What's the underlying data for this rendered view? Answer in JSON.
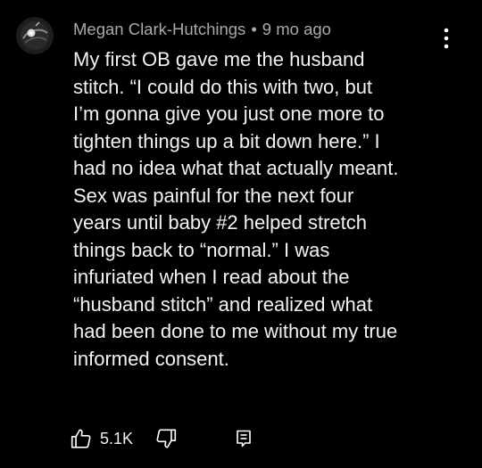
{
  "comment": {
    "author": "Megan Clark-Hutchings",
    "separator": "•",
    "timestamp": "9 mo ago",
    "text_lines": [
      "My first OB gave me the husband",
      "stitch. “I could do this with two, but",
      "I’m gonna give you just one more to",
      "tighten things up a bit down here.” I",
      "had no idea what that actually meant.",
      "Sex was painful for the next four",
      "years until baby #2 helped stretch",
      "things back to “normal.” I was",
      "infuriated when I read about the",
      "“husband stitch” and realized what",
      "had been done to me without my true",
      "informed consent."
    ],
    "likes": "5.1K"
  },
  "icons": {
    "avatar": "avatar-image",
    "more": "more-vertical-icon",
    "like": "thumbs-up-icon",
    "dislike": "thumbs-down-icon",
    "reply": "reply-comment-icon"
  },
  "colors": {
    "background": "#000000",
    "text": "#f2f2f2",
    "meta": "#a9a9a9"
  }
}
